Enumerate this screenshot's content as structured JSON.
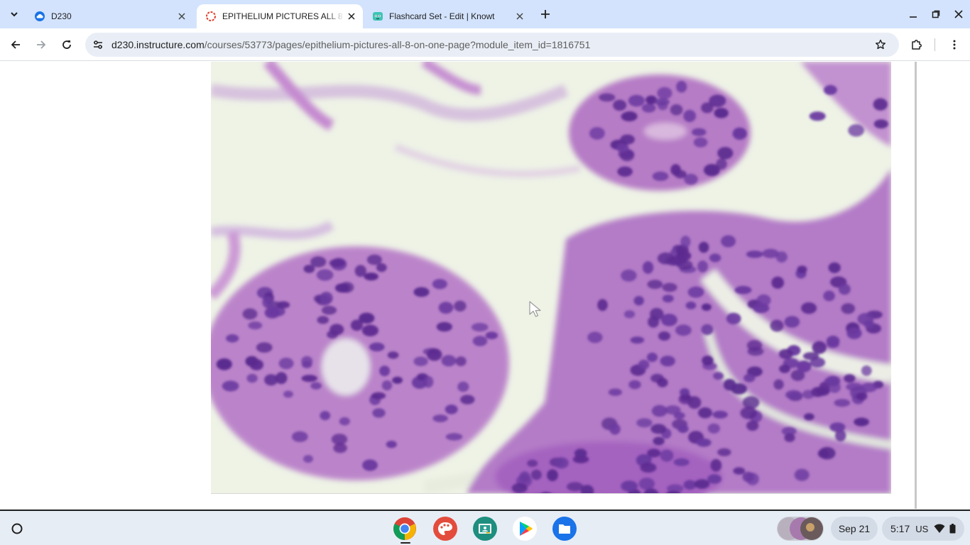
{
  "browser": {
    "tabs": [
      {
        "title": "D230",
        "favicon": "cloud-icon",
        "active": false
      },
      {
        "title": "EPITHELIUM PICTURES ALL 8 O",
        "favicon": "canvas-icon",
        "active": true
      },
      {
        "title": "Flashcard Set - Edit | Knowt",
        "favicon": "knowt-icon",
        "active": false
      }
    ],
    "url_host": "d230.instructure.com",
    "url_path": "/courses/53773/pages/epithelium-pictures-all-8-on-one-page?module_item_id=1816751"
  },
  "page": {
    "image_alt": "Epithelium micrograph",
    "image_description_colors": {
      "tissue": "#b778c6",
      "nuclei": "#5d2a8e",
      "background": "#eef3e6"
    }
  },
  "shelf": {
    "apps": [
      "chrome-icon",
      "canvas-paint-icon",
      "classroom-icon",
      "play-store-icon",
      "files-icon"
    ],
    "date": "Sep 21",
    "time": "5:17",
    "locale": "US"
  },
  "colors": {
    "tabstrip": "#d3e3fd",
    "omnibox": "#e9eef6",
    "shelf": "#e7edf5"
  }
}
